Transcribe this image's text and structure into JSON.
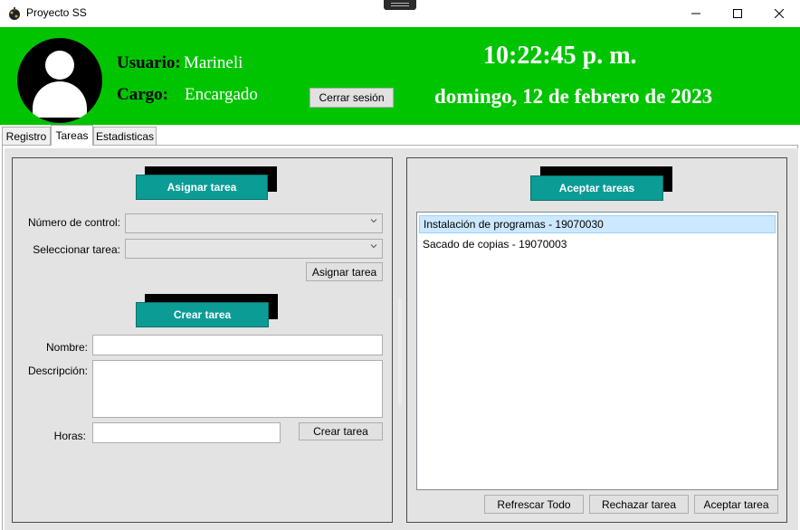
{
  "window": {
    "title": "Proyecto SS",
    "app_icon": "app-icon",
    "controls": [
      "minimize-icon",
      "maximize-icon",
      "close-icon"
    ]
  },
  "header": {
    "usuario_label": "Usuario:",
    "usuario_value": "Marineli",
    "cargo_label": "Cargo:",
    "cargo_value": "Encargado",
    "logout_label": "Cerrar sesión",
    "time": "10:22:45 p. m.",
    "date": "domingo, 12 de febrero de 2023",
    "background_color": "#00c400"
  },
  "tabs": [
    {
      "label": "Registro",
      "selected": false
    },
    {
      "label": "Tareas",
      "selected": true
    },
    {
      "label": "Estadisticas",
      "selected": false
    }
  ],
  "assign_section": {
    "title": "Asignar tarea",
    "control_label": "Número de control:",
    "control_value": "",
    "task_label": "Seleccionar tarea:",
    "task_value": "",
    "button_label": "Asignar tarea"
  },
  "create_section": {
    "title": "Crear tarea",
    "name_label": "Nombre:",
    "name_value": "",
    "description_label": "Descripción:",
    "description_value": "",
    "hours_label": "Horas:",
    "hours_value": "",
    "button_label": "Crear tarea"
  },
  "accept_section": {
    "title": "Aceptar tareas",
    "items": [
      {
        "text": "Instalación de programas - 19070030",
        "selected": true
      },
      {
        "text": "Sacado de copias - 19070003",
        "selected": false
      }
    ],
    "refresh_label": "Refrescar Todo",
    "reject_label": "Rechazar tarea",
    "accept_label": "Aceptar tarea"
  },
  "colors": {
    "banner": "#0b9c96",
    "selection": "#cce8ff"
  }
}
